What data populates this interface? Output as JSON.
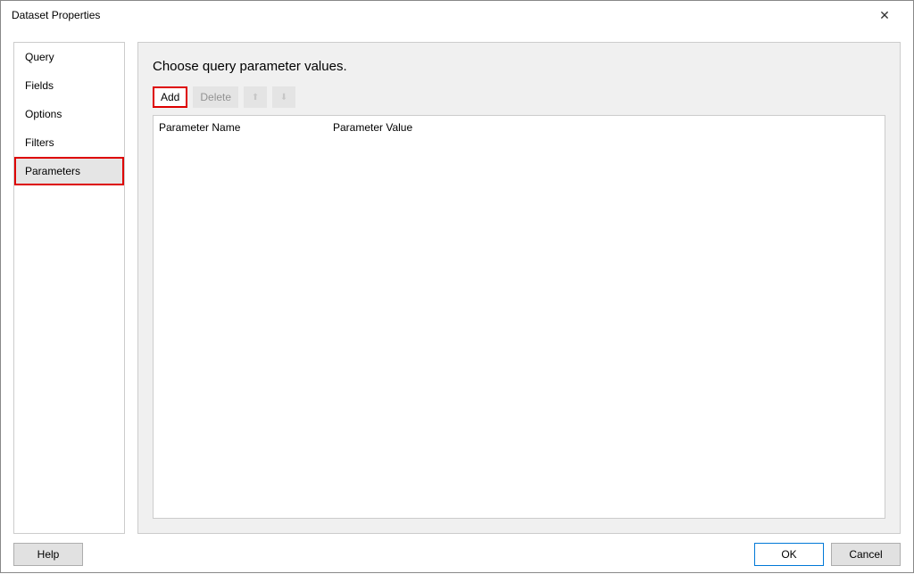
{
  "window": {
    "title": "Dataset Properties",
    "close_label": "✕"
  },
  "sidebar": {
    "items": [
      {
        "label": "Query",
        "selected": false
      },
      {
        "label": "Fields",
        "selected": false
      },
      {
        "label": "Options",
        "selected": false
      },
      {
        "label": "Filters",
        "selected": false
      },
      {
        "label": "Parameters",
        "selected": true
      }
    ]
  },
  "main": {
    "heading": "Choose query parameter values.",
    "toolbar": {
      "add_label": "Add",
      "delete_label": "Delete",
      "move_up_icon": "⬆",
      "move_down_icon": "⬇"
    },
    "columns": {
      "name": "Parameter Name",
      "value": "Parameter Value"
    },
    "rows": []
  },
  "footer": {
    "help_label": "Help",
    "ok_label": "OK",
    "cancel_label": "Cancel"
  }
}
